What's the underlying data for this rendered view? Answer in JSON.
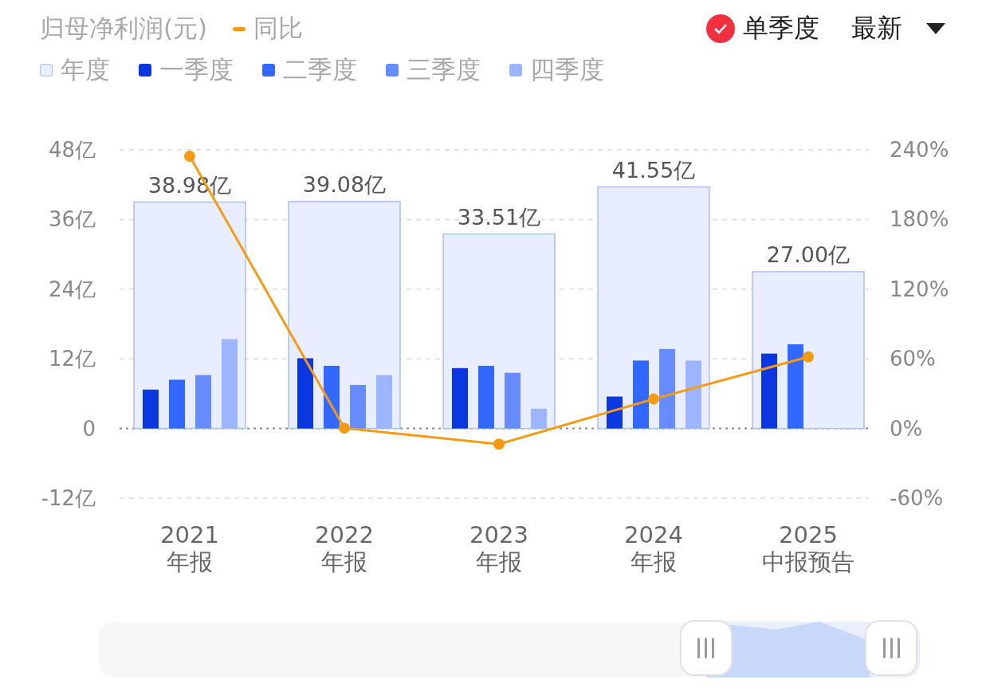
{
  "chart": {
    "chart_data": {
      "type": "bar",
      "title": "归母净利润(元)",
      "grid": true,
      "legend": "top",
      "ref_lines": [
        {
          "axis": "y",
          "value": 0
        }
      ],
      "categories": [
        "2021 年报",
        "2022 年报",
        "2023 年报",
        "2024 年报",
        "2025 中报预告"
      ],
      "ylim": [
        -12,
        48
      ],
      "y2lim": [
        -60,
        240
      ],
      "yticks": [
        {
          "value": 48,
          "label": "48亿"
        },
        {
          "value": 36,
          "label": "36亿"
        },
        {
          "value": 24,
          "label": "24亿"
        },
        {
          "value": 12,
          "label": "12亿"
        },
        {
          "value": 0,
          "label": "0"
        },
        {
          "value": -12,
          "label": "-12亿"
        }
      ],
      "y2ticks": [
        {
          "value": 240,
          "label": "240%"
        },
        {
          "value": 180,
          "label": "180%"
        },
        {
          "value": 120,
          "label": "120%"
        },
        {
          "value": 60,
          "label": "60%"
        },
        {
          "value": 0,
          "label": "0%"
        },
        {
          "value": -60,
          "label": "-60%"
        }
      ],
      "series": [
        {
          "name": "同比",
          "type": "line",
          "axis": "y2",
          "marker": "circle",
          "color": "#f59a12",
          "values": [
            234.5,
            0.3,
            -13.5,
            25.4,
            61.7
          ]
        },
        {
          "name": "年度",
          "type": "bar",
          "color": "#e8eeff",
          "values": [
            39.0,
            39.1,
            33.5,
            41.6,
            27.0
          ]
        },
        {
          "name": "一季度",
          "type": "bar",
          "color": "#0a37e0",
          "values": [
            6.7,
            12.1,
            10.4,
            5.5,
            12.9
          ]
        },
        {
          "name": "二季度",
          "type": "bar",
          "color": "#3368ff",
          "values": [
            8.4,
            10.8,
            10.8,
            11.7,
            14.5
          ]
        },
        {
          "name": "三季度",
          "type": "bar",
          "color": "#668cff",
          "values": [
            9.2,
            7.5,
            9.6,
            13.7,
            null
          ]
        },
        {
          "name": "四季度",
          "type": "bar",
          "color": "#9db5ff",
          "values": [
            15.4,
            9.2,
            3.4,
            11.7,
            null
          ]
        }
      ],
      "value_labels": [
        "38.98亿",
        "39.08亿",
        "33.51亿",
        "41.55亿",
        "27.00亿"
      ]
    }
  },
  "toggle": {
    "label": "单季度",
    "checked": true
  },
  "period_select": {
    "value": "最新"
  },
  "navigator": {
    "window_start": {
      "level": 0.74
    }
  }
}
